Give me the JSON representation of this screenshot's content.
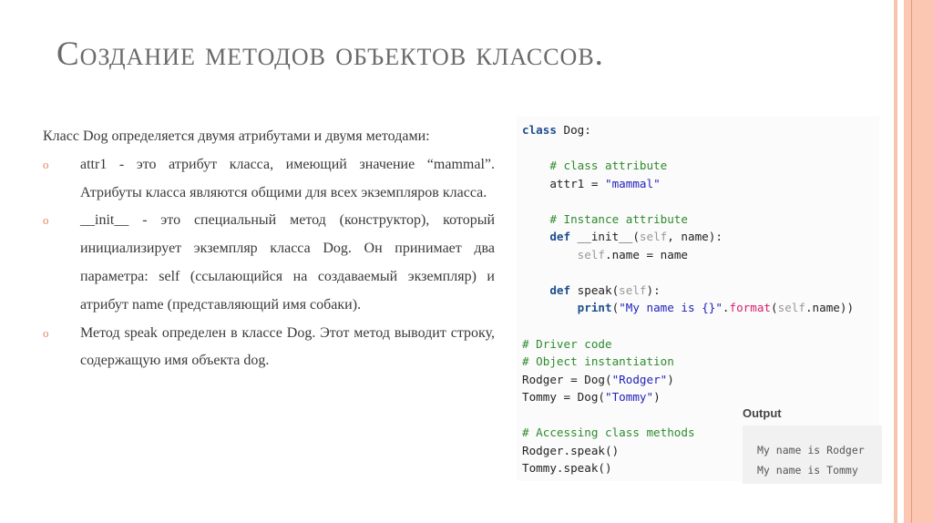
{
  "title": "Создание методов объектов классов.",
  "intro": "Класс Dog определяется двумя атрибутами и двумя методами:",
  "bullets": [
    "attr1 - это атрибут класса, имеющий значение “mammal”. Атрибуты класса являются общими для всех экземпляров класса.",
    "__init__ - это специальный метод (конструктор), который инициализирует экземпляр класса Dog. Он принимает два параметра: self (ссылающийся на создаваемый экземпляр) и атрибут name (представляющий имя собаки).",
    "Метод speak определен в классе Dog. Этот метод выводит строку, содержащую имя объекта dog."
  ],
  "bullet_marker": "o",
  "code_lines": [
    [
      [
        "class",
        "kw"
      ],
      [
        " Dog:",
        "tx"
      ]
    ],
    [],
    [
      [
        "    # class attribute",
        "cm"
      ]
    ],
    [
      [
        "    attr1 = ",
        "tx"
      ],
      [
        "\"mammal\"",
        "st"
      ]
    ],
    [],
    [
      [
        "    # Instance attribute",
        "cm"
      ]
    ],
    [
      [
        "    def",
        "kw"
      ],
      [
        " __init__(",
        "tx"
      ],
      [
        "self",
        "sf"
      ],
      [
        ", name):",
        "tx"
      ]
    ],
    [
      [
        "        ",
        "tx"
      ],
      [
        "self",
        "sf"
      ],
      [
        ".name = name",
        "tx"
      ]
    ],
    [],
    [
      [
        "    def",
        "kw"
      ],
      [
        " speak(",
        "tx"
      ],
      [
        "self",
        "sf"
      ],
      [
        "):",
        "tx"
      ]
    ],
    [
      [
        "        ",
        "tx"
      ],
      [
        "print",
        "kw"
      ],
      [
        "(",
        "tx"
      ],
      [
        "\"My name is {}\"",
        "st"
      ],
      [
        ".",
        "tx"
      ],
      [
        "format",
        "fn"
      ],
      [
        "(",
        "tx"
      ],
      [
        "self",
        "sf"
      ],
      [
        ".name))",
        "tx"
      ]
    ],
    [],
    [
      [
        "# Driver code",
        "cm"
      ]
    ],
    [
      [
        "# Object instantiation",
        "cm"
      ]
    ],
    [
      [
        "Rodger = Dog(",
        "tx"
      ],
      [
        "\"Rodger\"",
        "st"
      ],
      [
        ")",
        "tx"
      ]
    ],
    [
      [
        "Tommy = Dog(",
        "tx"
      ],
      [
        "\"Tommy\"",
        "st"
      ],
      [
        ")",
        "tx"
      ]
    ],
    [],
    [
      [
        "# Accessing class methods",
        "cm"
      ]
    ],
    [
      [
        "Rodger.speak()",
        "tx"
      ]
    ],
    [
      [
        "Tommy.speak()",
        "tx"
      ]
    ]
  ],
  "output": {
    "label": "Output",
    "lines": [
      "My name is Rodger",
      "My name is Tommy"
    ]
  },
  "colors": {
    "accent": "#f9c0aa",
    "accent_dark": "#e89a78",
    "bullet": "#e0876a"
  }
}
